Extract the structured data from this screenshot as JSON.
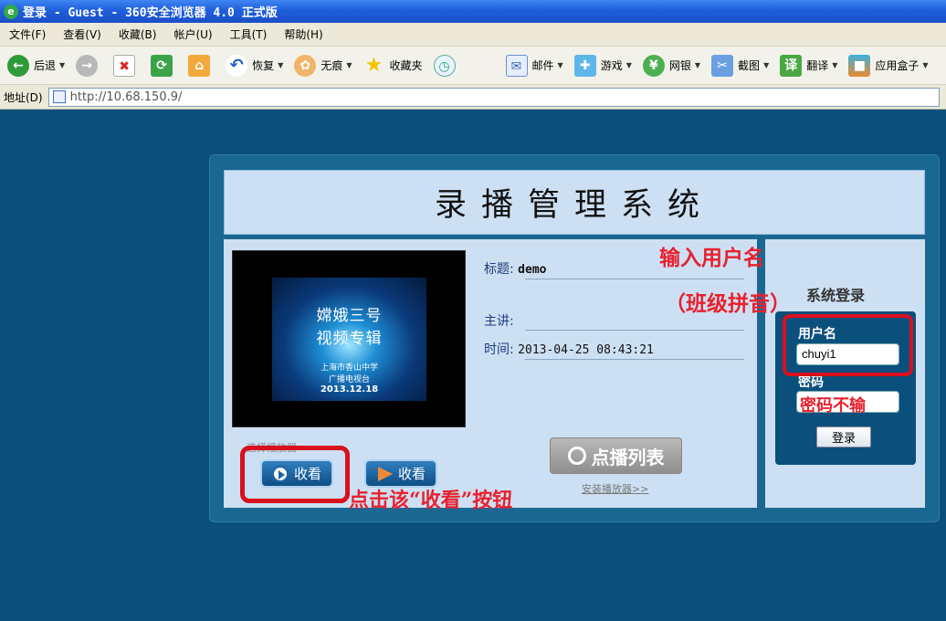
{
  "window": {
    "title": "登录 - Guest - 360安全浏览器 4.0 正式版",
    "app_icon": "e"
  },
  "menu": [
    "文件(F)",
    "查看(V)",
    "收藏(B)",
    "帐户(U)",
    "工具(T)",
    "帮助(H)"
  ],
  "toolbar": {
    "back": "后退",
    "restore": "恢复",
    "incognito": "无痕",
    "favorites": "收藏夹",
    "mail": "邮件",
    "games": "游戏",
    "bank": "网银",
    "screenshot": "截图",
    "translate": "翻译",
    "appbox": "应用盒子"
  },
  "address": {
    "label": "地址(D)",
    "url": "http://10.68.150.9/"
  },
  "page": {
    "system_title": "录播管理系统",
    "video": {
      "line1": "嫦娥三号",
      "line2": "视频专辑",
      "line3": "上海市香山中学",
      "line4": "广播电视台",
      "date": "2013.12.18"
    },
    "info": {
      "title_label": "标题:",
      "title_value": "demo",
      "speaker_label": "主讲:",
      "speaker_value": "",
      "time_label": "时间:",
      "time_value": "2013-04-25 08:43:21"
    },
    "player_label": "选择播放器",
    "watch_label_1": "收看",
    "watch_label_2": "收看",
    "vod_list": "点播列表",
    "install_player": "安装播放器>>",
    "login": {
      "title": "系统登录",
      "username_label": "用户名",
      "username_value": "chuyi1",
      "password_label": "密码",
      "login_button": "登录"
    }
  },
  "annotations": {
    "enter_username": "输入用户名",
    "class_pinyin": "（班级拼音）",
    "no_password": "密码不输",
    "click_watch": "点击该“收看”按钮",
    "color": "#e8212e"
  }
}
